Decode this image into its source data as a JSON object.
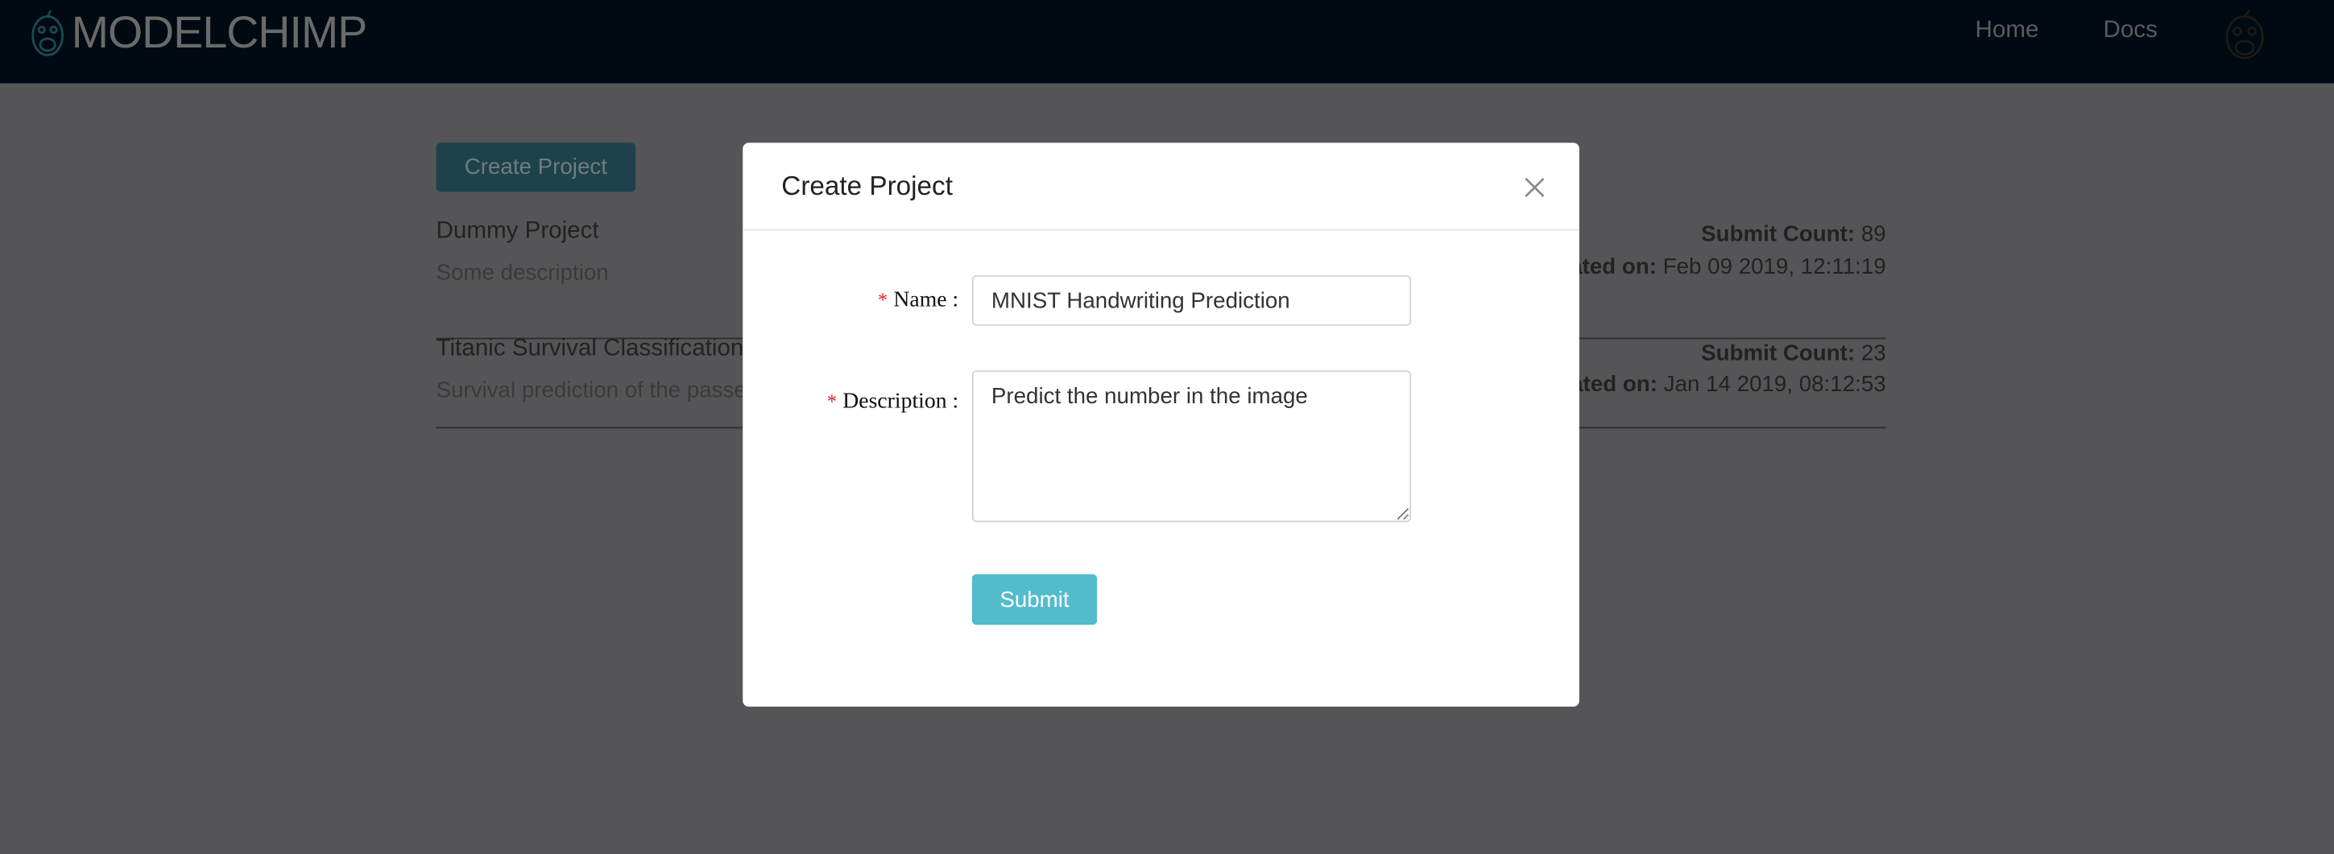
{
  "navbar": {
    "brand": "MODELCHIMP",
    "links": [
      {
        "label": "Home"
      },
      {
        "label": "Docs"
      }
    ]
  },
  "main": {
    "create_button": "Create Project",
    "projects": [
      {
        "name": "Dummy Project",
        "description": "Some description",
        "count_label": "Submit Count:",
        "count": "89",
        "created_label": "Created on:",
        "created": "Feb 09 2019, 12:11:19"
      },
      {
        "name": "Titanic Survival Classification",
        "description": "Survival prediction of the passengers",
        "count_label": "Submit Count:",
        "count": "23",
        "created_label": "Created on:",
        "created": "Jan 14 2019, 08:12:53"
      }
    ]
  },
  "modal": {
    "title": "Create Project",
    "required_mark": "*",
    "name_label": "Name",
    "name_value": "MNIST Handwriting Prediction",
    "description_label": "Description",
    "description_value": "Predict the number in the image",
    "submit_label": "Submit"
  },
  "colors": {
    "accent": "#52bccd",
    "navbar": "#010913",
    "required": "#e0202a"
  }
}
